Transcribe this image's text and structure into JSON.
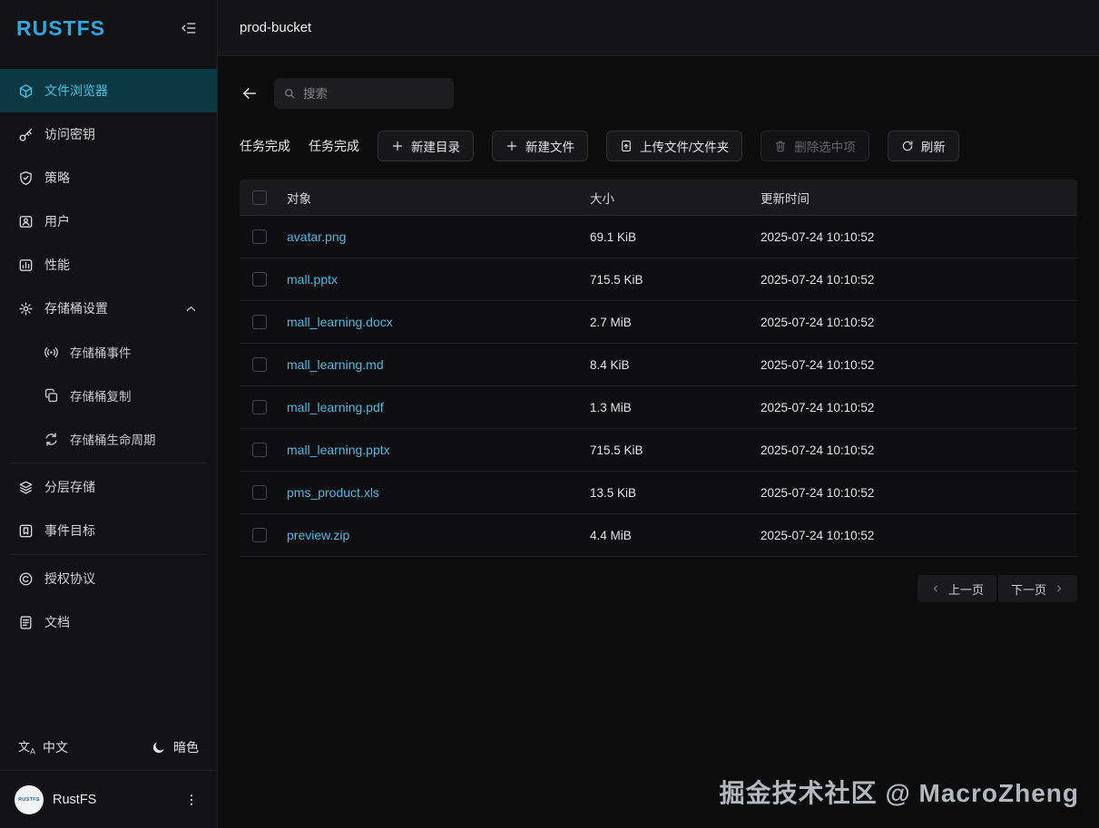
{
  "app": {
    "logo": "RUSTFS"
  },
  "header": {
    "title": "prod-bucket"
  },
  "sidebar": {
    "items": [
      {
        "id": "file-browser",
        "label": "文件浏览器",
        "icon": "cube-icon",
        "active": true
      },
      {
        "id": "access-keys",
        "label": "访问密钥",
        "icon": "key-icon"
      },
      {
        "id": "policies",
        "label": "策略",
        "icon": "shield-icon"
      },
      {
        "id": "users",
        "label": "用户",
        "icon": "user-icon"
      },
      {
        "id": "performance",
        "label": "性能",
        "icon": "chart-icon"
      },
      {
        "id": "bucket-settings",
        "label": "存储桶设置",
        "icon": "gear-icon",
        "expanded": true,
        "children": [
          {
            "id": "bucket-events",
            "label": "存储桶事件",
            "icon": "broadcast-icon"
          },
          {
            "id": "bucket-replication",
            "label": "存储桶复制",
            "icon": "copy-icon"
          },
          {
            "id": "bucket-lifecycle",
            "label": "存储桶生命周期",
            "icon": "lifecycle-icon"
          }
        ]
      },
      {
        "divider": true
      },
      {
        "id": "tiered-storage",
        "label": "分层存储",
        "icon": "layers-icon"
      },
      {
        "id": "event-targets",
        "label": "事件目标",
        "icon": "bookmark-icon"
      },
      {
        "divider": true
      },
      {
        "id": "license",
        "label": "授权协议",
        "icon": "license-icon"
      },
      {
        "id": "docs",
        "label": "文档",
        "icon": "document-icon"
      }
    ],
    "language_label": "中文",
    "theme_label": "暗色",
    "footer_app_name": "RustFS",
    "avatar_text": "RUSTFS"
  },
  "toolbar": {
    "search_placeholder": "搜索",
    "status_labels": [
      "任务完成",
      "任务完成"
    ],
    "buttons": [
      {
        "id": "new-folder",
        "label": "新建目录",
        "icon": "plus-icon"
      },
      {
        "id": "new-file",
        "label": "新建文件",
        "icon": "plus-icon"
      },
      {
        "id": "upload-files",
        "label": "上传文件/文件夹",
        "icon": "upload-icon"
      },
      {
        "id": "delete-selected",
        "label": "删除选中项",
        "icon": "trash-icon",
        "disabled": true
      },
      {
        "id": "refresh",
        "label": "刷新",
        "icon": "refresh-icon"
      }
    ]
  },
  "table": {
    "columns": [
      "对象",
      "大小",
      "更新时间"
    ],
    "rows": [
      {
        "name": "avatar.png",
        "size": "69.1 KiB",
        "updated": "2025-07-24 10:10:52"
      },
      {
        "name": "mall.pptx",
        "size": "715.5 KiB",
        "updated": "2025-07-24 10:10:52"
      },
      {
        "name": "mall_learning.docx",
        "size": "2.7 MiB",
        "updated": "2025-07-24 10:10:52"
      },
      {
        "name": "mall_learning.md",
        "size": "8.4 KiB",
        "updated": "2025-07-24 10:10:52"
      },
      {
        "name": "mall_learning.pdf",
        "size": "1.3 MiB",
        "updated": "2025-07-24 10:10:52"
      },
      {
        "name": "mall_learning.pptx",
        "size": "715.5 KiB",
        "updated": "2025-07-24 10:10:52"
      },
      {
        "name": "pms_product.xls",
        "size": "13.5 KiB",
        "updated": "2025-07-24 10:10:52"
      },
      {
        "name": "preview.zip",
        "size": "4.4 MiB",
        "updated": "2025-07-24 10:10:52"
      }
    ]
  },
  "pagination": {
    "prev": "上一页",
    "next": "下一页"
  },
  "watermark": "掘金技术社区 @ MacroZheng",
  "colors": {
    "accent": "#2ba8e0",
    "link": "#49b9e4",
    "active_bg": "#0c3843"
  }
}
